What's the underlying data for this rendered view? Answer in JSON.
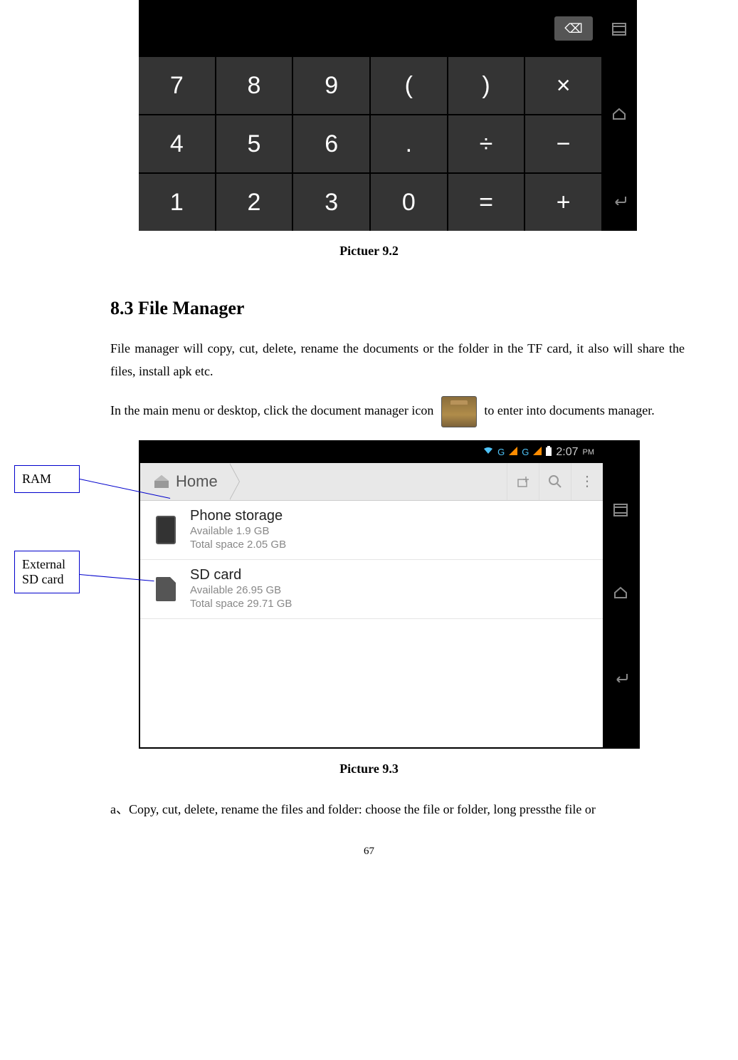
{
  "calculator": {
    "keys": [
      "7",
      "8",
      "9",
      "(",
      ")",
      "×",
      "4",
      "5",
      "6",
      ".",
      "÷",
      "−",
      "1",
      "2",
      "3",
      "0",
      "=",
      "+"
    ],
    "del_icon": "⌫"
  },
  "caption1": "Pictuer 9.2",
  "section": {
    "heading": "8.3 File Manager",
    "para1": "File manager will copy, cut, delete, rename the documents or the folder in the TF card, it also will share the files, install apk etc.",
    "para2a": "In the main menu or desktop, click the document manager icon ",
    "para2b": " to enter into documents manager."
  },
  "fm": {
    "status": {
      "time": "2:07",
      "ampm": "PM",
      "g_label": "G",
      "battery": "▮"
    },
    "home_label": "Home",
    "items": [
      {
        "title": "Phone storage",
        "available": "Available 1.9 GB",
        "total": "Total space 2.05 GB"
      },
      {
        "title": "SD card",
        "available": "Available 26.95 GB",
        "total": "Total space 29.71 GB"
      }
    ]
  },
  "callouts": {
    "ram": "RAM",
    "sd": "External SD card"
  },
  "caption2": "Picture 9.3",
  "bottom_line": "a、Copy, cut, delete, rename the files and folder: choose the file or folder, long pressthe file or",
  "pagenum": "67"
}
